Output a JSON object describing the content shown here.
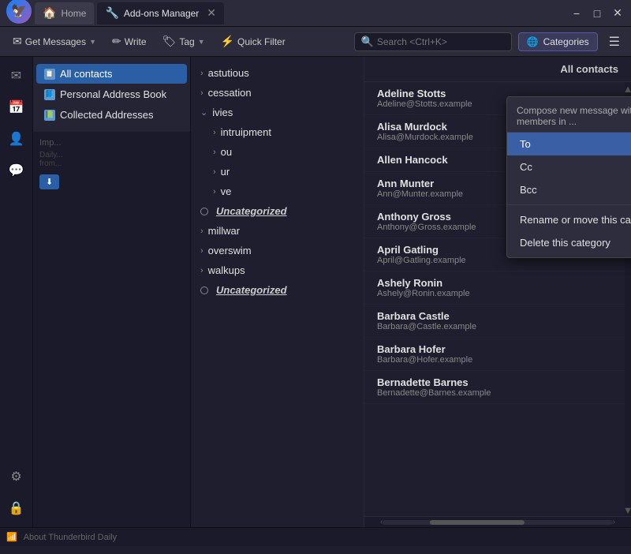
{
  "titlebar": {
    "app_icon": "🦅",
    "tabs": [
      {
        "id": "home",
        "label": "Home",
        "icon": "🏠",
        "active": false
      },
      {
        "id": "addons",
        "label": "Add-ons Manager",
        "icon": "🔧",
        "active": true
      }
    ],
    "controls": [
      "−",
      "□",
      "✕"
    ]
  },
  "toolbar": {
    "buttons": [
      {
        "id": "get-messages",
        "label": "Get Messages",
        "icon": "✉",
        "has_dropdown": true
      },
      {
        "id": "write",
        "label": "Write",
        "icon": "✏"
      },
      {
        "id": "tag",
        "label": "Tag",
        "icon": "🏷",
        "has_dropdown": true
      },
      {
        "id": "quick-filter",
        "label": "Quick Filter",
        "icon": "⚡"
      }
    ],
    "search_placeholder": "Search <Ctrl+K>",
    "categories_label": "Categories",
    "categories_icon": "🌐",
    "menu_icon": "☰"
  },
  "address_book": {
    "all_contacts_label": "All contacts",
    "items": [
      {
        "id": "all-contacts",
        "label": "All contacts",
        "active": true
      },
      {
        "id": "personal",
        "label": "Personal Address Book"
      },
      {
        "id": "collected",
        "label": "Collected Addresses"
      }
    ]
  },
  "categories": {
    "items": [
      {
        "id": "astutious",
        "label": "astutious",
        "type": "arrow"
      },
      {
        "id": "cessation",
        "label": "cessation",
        "type": "arrow"
      },
      {
        "id": "ivies",
        "label": "ivies",
        "type": "arrow-open",
        "children": [
          {
            "id": "intruipment",
            "label": "intruipment",
            "type": "arrow"
          },
          {
            "id": "ou",
            "label": "ou",
            "type": "arrow"
          },
          {
            "id": "ur",
            "label": "ur",
            "type": "arrow"
          },
          {
            "id": "ve",
            "label": "ve",
            "type": "arrow"
          }
        ]
      },
      {
        "id": "Uncategorized1",
        "label": "Uncategorized",
        "type": "radio",
        "italic": true
      },
      {
        "id": "millwar",
        "label": "millwar",
        "type": "arrow"
      },
      {
        "id": "overswim",
        "label": "overswim",
        "type": "arrow"
      },
      {
        "id": "walkups",
        "label": "walkups",
        "type": "arrow"
      },
      {
        "id": "Uncategorized2",
        "label": "Uncategorized",
        "type": "radio",
        "italic": true
      }
    ]
  },
  "contacts_header": "All contacts",
  "contacts": [
    {
      "name": "Adeline Stotts",
      "email": "Adeline@Stotts.example"
    },
    {
      "name": "Alisa Murdock",
      "email": "Alisa@Murdock.example"
    },
    {
      "name": "Allen Hancock",
      "email": ""
    },
    {
      "name": "Ann Munter",
      "email": "Ann@Munter.example"
    },
    {
      "name": "Anthony Gross",
      "email": "Anthony@Gross.example"
    },
    {
      "name": "April Gatling",
      "email": "April@Gatling.example"
    },
    {
      "name": "Ashely Ronin",
      "email": "Ashely@Ronin.example"
    },
    {
      "name": "Barbara Castle",
      "email": "Barbara@Castle.example"
    },
    {
      "name": "Barbara Hofer",
      "email": "Barbara@Hofer.example"
    },
    {
      "name": "Bernadette Barnes",
      "email": "Bernadette@Barnes.example"
    }
  ],
  "context_menu": {
    "header": "Compose new message with category members in ...",
    "items": [
      {
        "id": "to",
        "label": "To",
        "highlight": true
      },
      {
        "id": "cc",
        "label": "Cc"
      },
      {
        "id": "bcc",
        "label": "Bcc"
      },
      {
        "id": "rename",
        "label": "Rename or move this category"
      },
      {
        "id": "delete",
        "label": "Delete this category"
      }
    ]
  },
  "status_bar": {
    "text": "About Thunderbird Daily",
    "wifi_icon": "wifi"
  },
  "icons": {
    "search": "🔍",
    "rainbow": "🌐",
    "envelope": "✉",
    "pencil": "✏",
    "tag": "🏷",
    "lightning": "⚡",
    "menu": "☰",
    "arrow_right": "›",
    "arrow_down": "∨",
    "radio_empty": "○",
    "chevron_left": "‹",
    "chevron_right": "›"
  }
}
